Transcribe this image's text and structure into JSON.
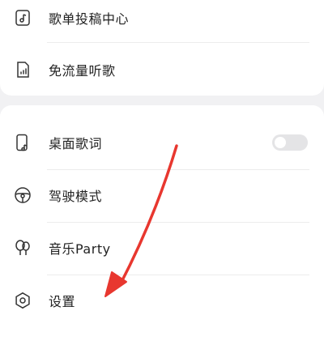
{
  "menu_top": {
    "items": [
      {
        "icon": "music-note-doc-icon",
        "label": "歌单投稿中心"
      },
      {
        "icon": "signal-sim-icon",
        "label": "免流量听歌"
      }
    ]
  },
  "menu_bottom": {
    "items": [
      {
        "icon": "phone-lyrics-icon",
        "label": "桌面歌词",
        "toggle": "off"
      },
      {
        "icon": "steering-wheel-icon",
        "label": "驾驶模式"
      },
      {
        "icon": "balloon-icon",
        "label": "音乐Party"
      },
      {
        "icon": "gear-icon",
        "label": "设置"
      }
    ]
  },
  "colors": {
    "background": "#f1f1f3",
    "card": "#ffffff",
    "arrow": "#e8372f",
    "toggle_off": "#e4e4e6"
  }
}
